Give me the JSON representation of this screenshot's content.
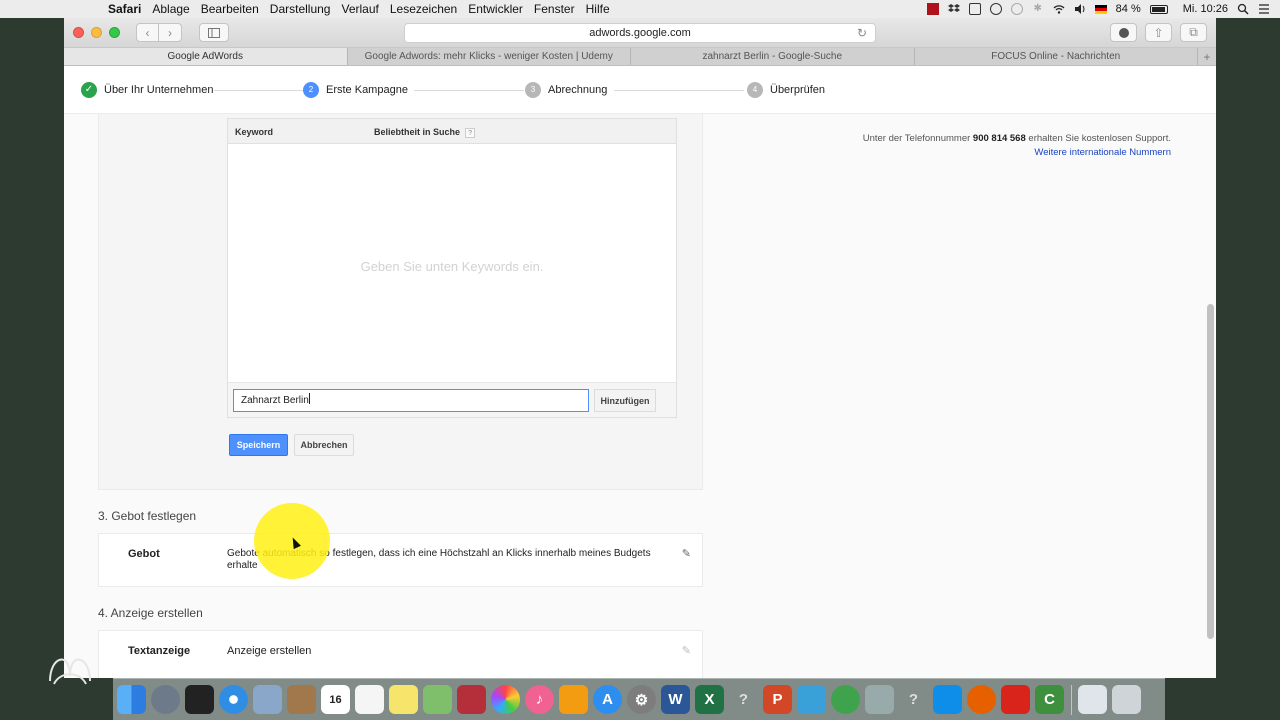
{
  "menubar": {
    "app": "Safari",
    "items": [
      "Ablage",
      "Bearbeiten",
      "Darstellung",
      "Verlauf",
      "Lesezeichen",
      "Entwickler",
      "Fenster",
      "Hilfe"
    ],
    "battery": "84 %",
    "clock": "Mi. 10:26"
  },
  "browser": {
    "url": "adwords.google.com",
    "tabs": [
      "Google AdWords",
      "Google Adwords: mehr Klicks - weniger Kosten | Udemy",
      "zahnarzt Berlin - Google-Suche",
      "FOCUS Online - Nachrichten"
    ],
    "new_tab": "+"
  },
  "steps": [
    {
      "label": "Über Ihr Unternehmen",
      "marker": "✓"
    },
    {
      "label": "Erste Kampagne",
      "marker": "2"
    },
    {
      "label": "Abrechnung",
      "marker": "3"
    },
    {
      "label": "Überprüfen",
      "marker": "4"
    }
  ],
  "keywords": {
    "col_keyword": "Keyword",
    "col_popularity": "Beliebtheit in Suche",
    "help": "?",
    "empty_message": "Geben Sie unten Keywords ein.",
    "input_value": "Zahnarzt Berlin",
    "add_label": "Hinzufügen",
    "save_label": "Speichern",
    "cancel_label": "Abbrechen"
  },
  "support": {
    "prefix": "Unter der Telefonnummer",
    "number": "900 814 568",
    "suffix": "erhalten Sie kostenlosen Support.",
    "link": "Weitere internationale Nummern"
  },
  "bid": {
    "title": "3. Gebot festlegen",
    "label": "Gebot",
    "value": "Gebote automatisch so festlegen, dass ich eine Höchstzahl an Klicks innerhalb meines Budgets erhalte"
  },
  "ad": {
    "title": "4. Anzeige erstellen",
    "label": "Textanzeige",
    "link": "Anzeige erstellen"
  },
  "colors": {
    "accent": "#4d90fe",
    "step_done": "#2aa44a",
    "step_current": "#4d90fe",
    "step_pending": "#b7b7b7",
    "link": "#1a44c0",
    "highlight": "#fff014"
  }
}
